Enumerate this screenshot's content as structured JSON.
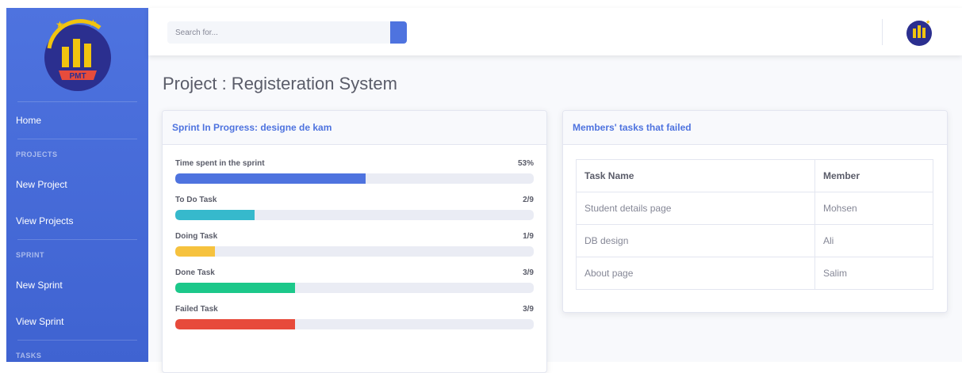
{
  "search": {
    "placeholder": "Search for..."
  },
  "sidebar": {
    "logo_text": "PMT",
    "home": "Home",
    "sections": [
      {
        "heading": "PROJECTS",
        "items": [
          "New Project",
          "View Projects"
        ]
      },
      {
        "heading": "SPRINT",
        "items": [
          "New Sprint",
          "View Sprint"
        ]
      },
      {
        "heading": "TASKS",
        "items": []
      }
    ]
  },
  "page": {
    "title": "Project : Registeration System"
  },
  "sprint_card": {
    "title": "Sprint In Progress: designe de kam",
    "progress": [
      {
        "label": "Time spent in the sprint",
        "value": "53%",
        "fraction": 0.53,
        "color": "#4e73df"
      },
      {
        "label": "To Do Task",
        "value": "2/9",
        "fraction": 0.222,
        "color": "#36b9cc"
      },
      {
        "label": "Doing Task",
        "value": "1/9",
        "fraction": 0.111,
        "color": "#f6c23e"
      },
      {
        "label": "Done Task",
        "value": "3/9",
        "fraction": 0.333,
        "color": "#1cc88a"
      },
      {
        "label": "Failed Task",
        "value": "3/9",
        "fraction": 0.333,
        "color": "#e74a3b"
      }
    ]
  },
  "failed_card": {
    "title": "Members' tasks that failed",
    "columns": [
      "Task Name",
      "Member"
    ],
    "rows": [
      [
        "Student details page",
        "Mohsen"
      ],
      [
        "DB design",
        "Ali"
      ],
      [
        "About page",
        "Salim"
      ]
    ]
  },
  "colors": {
    "primary": "#4e73df",
    "info": "#36b9cc",
    "warning": "#f6c23e",
    "success": "#1cc88a",
    "danger": "#e74a3b"
  }
}
